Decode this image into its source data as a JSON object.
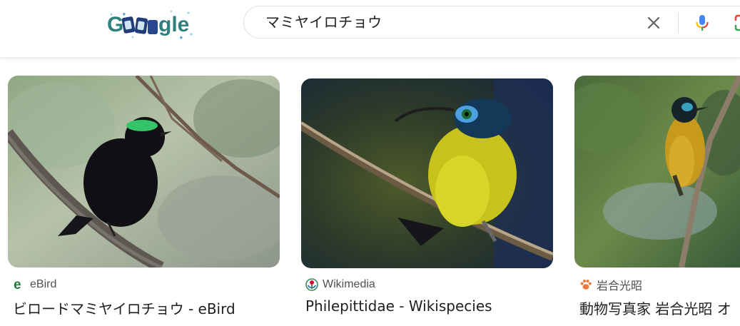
{
  "header": {
    "logo_text": "Google",
    "search": {
      "value": "マミヤイロチョウ",
      "clear_icon": "close-icon",
      "mic_icon": "microphone-icon",
      "lens_icon": "google-lens-icon"
    }
  },
  "results": [
    {
      "source": "eBird",
      "source_icon": "ebird-logo-icon",
      "title": "ビロードマミヤイロチョウ - eBird"
    },
    {
      "source": "Wikimedia",
      "source_icon": "wikimedia-logo-icon",
      "title": "Philepittidae - Wikispecies"
    },
    {
      "source": "岩合光昭",
      "source_icon": "paw-print-icon",
      "title": "動物写真家 岩合光昭 オ"
    }
  ],
  "colors": {
    "ebird_green": "#1f7a3a",
    "title_text": "#1f1f1f",
    "source_text": "#4d5156",
    "paw_orange": "#ea7a3c"
  }
}
